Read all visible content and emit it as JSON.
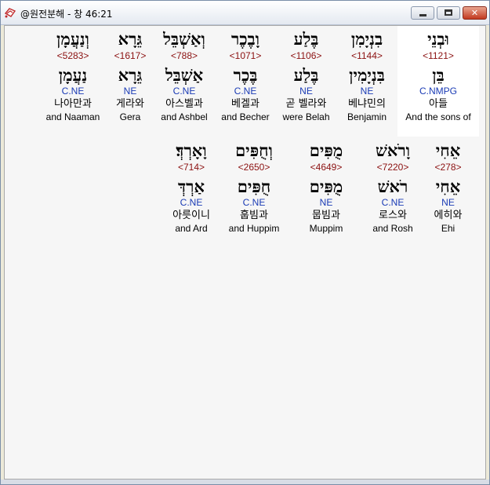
{
  "window": {
    "title": "@원전분해 - 창 46:21",
    "icon": "app-logo-icon",
    "buttons": {
      "minimize": "minimize-icon",
      "maximize": "maximize-icon",
      "close": "close-icon"
    }
  },
  "colors": {
    "strongs": "#8b1010",
    "morph": "#1a3bb5",
    "text": "#000000",
    "background": "#f6f6f6",
    "selected": "#ffffff"
  },
  "row1": [
    {
      "hebrew": "וּבְנֵי",
      "strongs": "<1121>",
      "lemma": "בֵּן",
      "morph": "C.NMPG",
      "korean": "아들",
      "english": "And the sons of"
    },
    {
      "hebrew": "בִנְיָמִן",
      "strongs": "<1144>",
      "lemma": "בִּנְיָמִין",
      "morph": "NE",
      "korean": "베냐민의",
      "english": "Benjamin"
    },
    {
      "hebrew": "בֶּלַע",
      "strongs": "<1106>",
      "lemma": "בֶּלַע",
      "morph": "NE",
      "korean": "곧 벨라와",
      "english": "were Belah"
    },
    {
      "hebrew": "וָבֶכֶר",
      "strongs": "<1071>",
      "lemma": "בֶּכֶר",
      "morph": "C.NE",
      "korean": "베겔과",
      "english": "and Becher"
    },
    {
      "hebrew": "וְאַשְׁבֵּל",
      "strongs": "<788>",
      "lemma": "אַשְׁבֵּל",
      "morph": "C.NE",
      "korean": "아스벨과",
      "english": "and Ashbel"
    },
    {
      "hebrew": "גֵּרָא",
      "strongs": "<1617>",
      "lemma": "גֵּרָא",
      "morph": "NE",
      "korean": "게라와",
      "english": "Gera"
    },
    {
      "hebrew": "וְנַעֲמָן",
      "strongs": "<5283>",
      "lemma": "נַעֲמָן",
      "morph": "C.NE",
      "korean": "나아만과",
      "english": "and Naaman"
    }
  ],
  "row2": [
    {
      "hebrew": "אֵחִי",
      "strongs": "<278>",
      "lemma": "אֵחִי",
      "morph": "NE",
      "korean": "에히와",
      "english": "Ehi"
    },
    {
      "hebrew": "וָרֹאשׁ",
      "strongs": "<7220>",
      "lemma": "רֹאשׁ",
      "morph": "C.NE",
      "korean": "로스와",
      "english": "and Rosh"
    },
    {
      "hebrew": "מֻפִּים",
      "strongs": "<4649>",
      "lemma": "מֻפִּים",
      "morph": "NE",
      "korean": "뭅빔과",
      "english": "Muppim"
    },
    {
      "hebrew": "וְחֻפִּים",
      "strongs": "<2650>",
      "lemma": "חֻפִּים",
      "morph": "C.NE",
      "korean": "훕빔과",
      "english": "and Huppim"
    },
    {
      "hebrew": "וָאָרְדְּ׃",
      "strongs": "<714>",
      "lemma": "אַרְדְּ",
      "morph": "C.NE",
      "korean": "아릇이니",
      "english": "and Ard"
    }
  ]
}
